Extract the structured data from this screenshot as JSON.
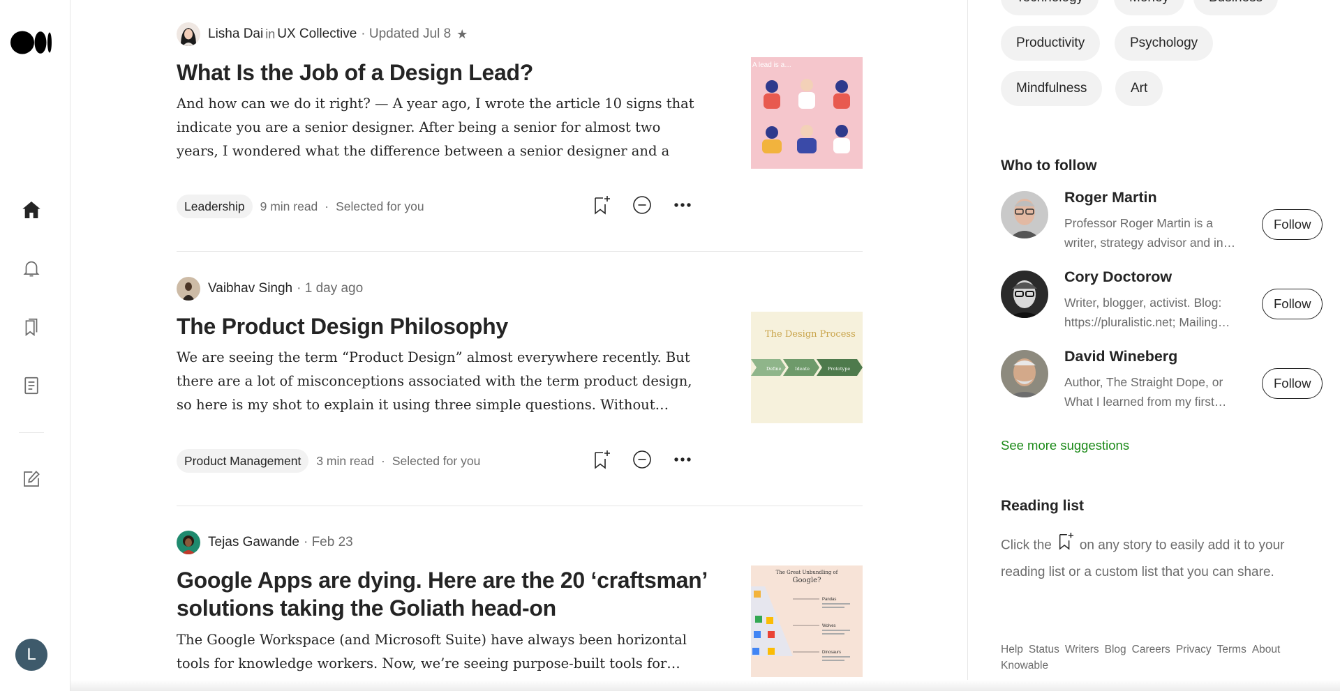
{
  "rail": {
    "avatar_letter": "L"
  },
  "articles": [
    {
      "author": "Lisha Dai",
      "in_label": "in",
      "publication": "UX Collective",
      "meta": "· Updated Jul 8",
      "star": "★",
      "title": "What Is the Job of a Design Lead?",
      "excerpt": "And how can we do it right? — A year ago, I wrote the article 10 signs that indicate you are a senior designer. After being a senior for almost two years, I wondered what the difference between a senior designer and a design…",
      "tag": "Leadership",
      "read_time": "9 min read",
      "reason": "Selected for you",
      "thumb_text": "A lead is a…"
    },
    {
      "author": "Vaibhav Singh",
      "meta": "· 1 day ago",
      "title": "The Product Design Philosophy",
      "excerpt": "We are seeing the term “Product Design” almost everywhere recently. But there are a lot of misconceptions associated with the term product design, so here is my shot to explain it using three simple questions. Without…",
      "tag": "Product Management",
      "read_time": "3 min read",
      "reason": "Selected for you",
      "thumb_title": "The Design Process",
      "thumb_steps": [
        "Define",
        "Ideate",
        "Prototype"
      ]
    },
    {
      "author": "Tejas Gawande",
      "meta": "· Feb 23",
      "title": "Google Apps are dying. Here are the 20 ‘craftsman’ solutions taking the Goliath head-on",
      "excerpt": "The Google Workspace (and Microsoft Suite) have always been horizontal tools for knowledge workers. Now, we’re seeing purpose-built tools for…",
      "thumb_title": "The Great Unbundling of",
      "thumb_title2": "Google?",
      "thumb_labels": [
        "Pandas",
        "Wolves",
        "Dinosaurs"
      ]
    }
  ],
  "sidebar": {
    "topics_top": [
      "Technology",
      "Money",
      "Business"
    ],
    "topics": [
      "Productivity",
      "Psychology",
      "Mindfulness",
      "Art"
    ],
    "who_to_follow": "Who to follow",
    "people": [
      {
        "name": "Roger Martin",
        "desc": "Professor Roger Martin is a writer, strategy advisor and in…",
        "button": "Follow"
      },
      {
        "name": "Cory Doctorow",
        "desc": "Writer, blogger, activist. Blog: https://pluralistic.net; Mailing…",
        "button": "Follow"
      },
      {
        "name": "David Wineberg",
        "desc": "Author, The Straight Dope, or What I learned from my first…",
        "button": "Follow"
      }
    ],
    "see_more": "See more suggestions",
    "reading_list_title": "Reading list",
    "reading_list_pre": "Click the",
    "reading_list_post": "on any story to easily add it to your reading list or a custom list that you can share.",
    "footer": [
      "Help",
      "Status",
      "Writers",
      "Blog",
      "Careers",
      "Privacy",
      "Terms",
      "About",
      "Knowable"
    ]
  }
}
